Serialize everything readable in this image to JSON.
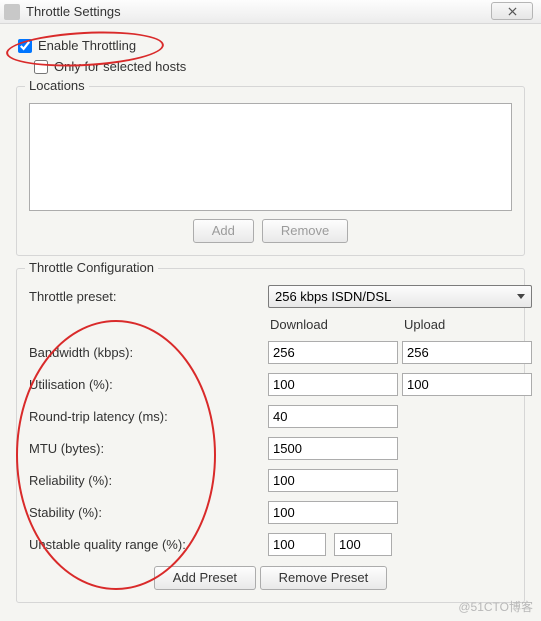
{
  "titlebar": {
    "title": "Throttle Settings"
  },
  "checkboxes": {
    "enable_label": "Enable Throttling",
    "enable_checked": true,
    "only_hosts_label": "Only for selected hosts",
    "only_hosts_checked": false
  },
  "locations": {
    "group_title": "Locations",
    "add_label": "Add",
    "remove_label": "Remove"
  },
  "config": {
    "group_title": "Throttle Configuration",
    "preset_label": "Throttle preset:",
    "preset_value": "256 kbps ISDN/DSL",
    "col_download": "Download",
    "col_upload": "Upload",
    "rows": {
      "bandwidth_label": "Bandwidth (kbps):",
      "bandwidth_down": "256",
      "bandwidth_up": "256",
      "utilisation_label": "Utilisation (%):",
      "utilisation_down": "100",
      "utilisation_up": "100",
      "rtt_label": "Round-trip latency (ms):",
      "rtt_value": "40",
      "mtu_label": "MTU (bytes):",
      "mtu_value": "1500",
      "reliability_label": "Reliability (%):",
      "reliability_value": "100",
      "stability_label": "Stability (%):",
      "stability_value": "100",
      "unstable_label": "Unstable quality range (%):",
      "unstable_min": "100",
      "unstable_max": "100"
    },
    "add_preset_label": "Add Preset",
    "remove_preset_label": "Remove Preset"
  },
  "watermark": "@51CTO博客"
}
